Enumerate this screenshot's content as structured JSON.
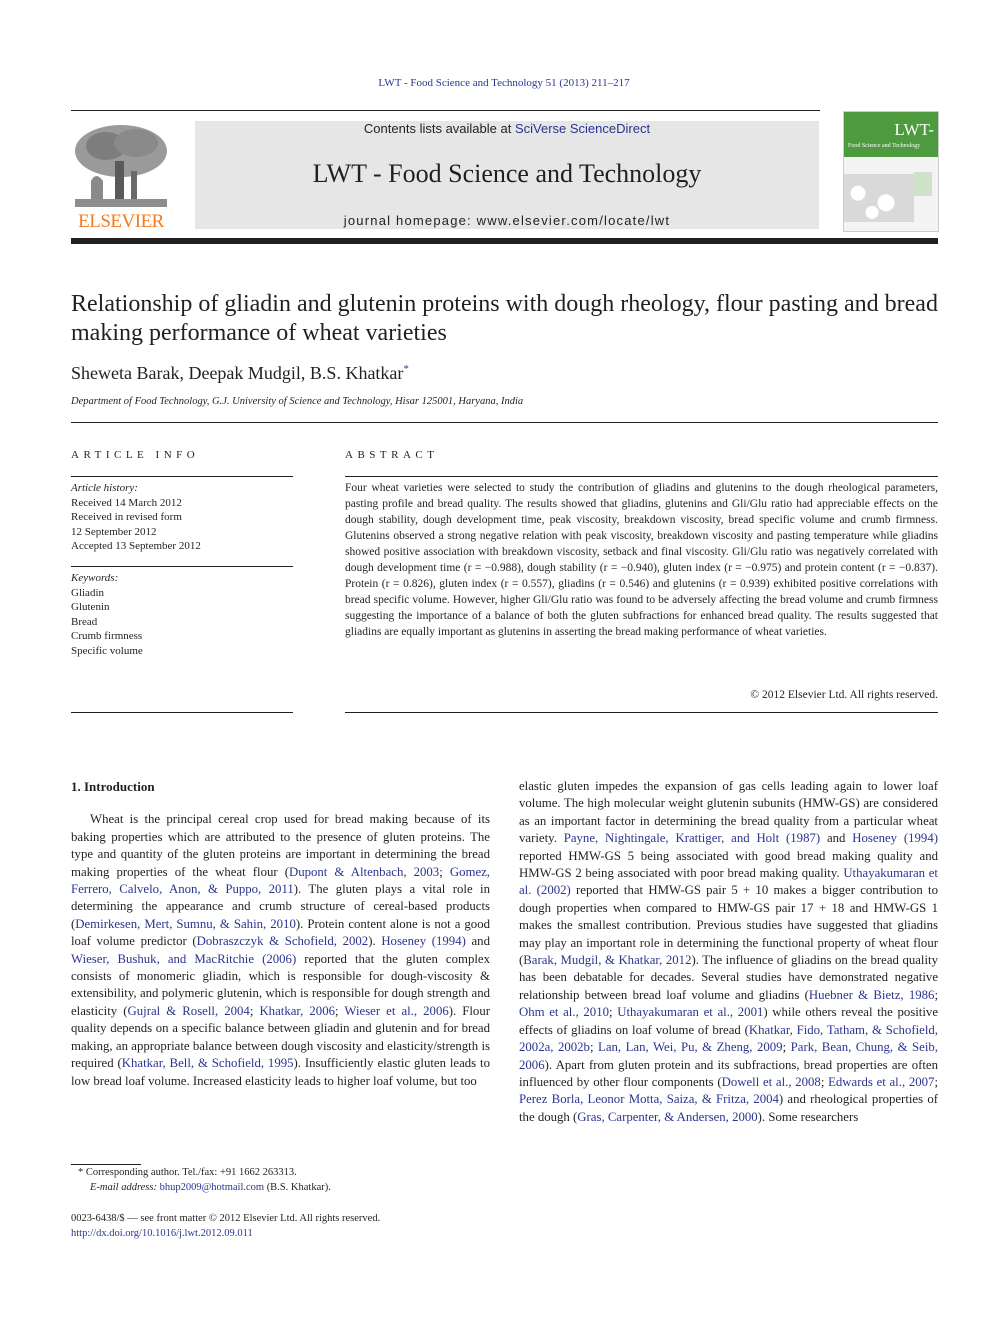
{
  "header": {
    "running_head": "LWT - Food Science and Technology 51 (2013) 211–217",
    "contents_prefix": "Contents lists available at ",
    "contents_link": "SciVerse ScienceDirect",
    "journal_title": "LWT - Food Science and Technology",
    "homepage": "journal homepage: www.elsevier.com/locate/lwt",
    "publisher_logo_text": "ELSEVIER",
    "cover_title": "LWT-",
    "cover_subtitle": "Food Science and Technology"
  },
  "colors": {
    "link": "#2a3590",
    "elsevier_orange": "#f47b20",
    "cover_green": "#4e9a3f",
    "banner_gray": "#e6e6e6"
  },
  "article": {
    "title": "Relationship of gliadin and glutenin proteins with dough rheology, flour pasting and bread making performance of wheat varieties",
    "authors": "Sheweta Barak, Deepak Mudgil, B.S. Khatkar",
    "author_mark": "*",
    "affiliation": "Department of Food Technology, G.J. University of Science and Technology, Hisar 125001, Haryana, India"
  },
  "article_info": {
    "heading": "ARTICLE INFO",
    "history_label": "Article history:",
    "history": [
      "Received 14 March 2012",
      "Received in revised form",
      "12 September 2012",
      "Accepted 13 September 2012"
    ],
    "keywords_label": "Keywords:",
    "keywords": [
      "Gliadin",
      "Glutenin",
      "Bread",
      "Crumb firmness",
      "Specific volume"
    ]
  },
  "abstract": {
    "heading": "ABSTRACT",
    "text": "Four wheat varieties were selected to study the contribution of gliadins and glutenins to the dough rheological parameters, pasting profile and bread quality. The results showed that gliadins, glutenins and Gli/Glu ratio had appreciable effects on the dough stability, dough development time, peak viscosity, breakdown viscosity, bread specific volume and crumb firmness. Glutenins observed a strong negative relation with peak viscosity, breakdown viscosity and pasting temperature while gliadins showed positive association with breakdown viscosity, setback and final viscosity. Gli/Glu ratio was negatively correlated with dough development time (r = −0.988), dough stability (r = −0.940), gluten index (r = −0.975) and protein content (r = −0.837). Protein (r = 0.826), gluten index (r = 0.557), gliadins (r = 0.546) and glutenins (r = 0.939) exhibited positive correlations with bread specific volume. However, higher Gli/Glu ratio was found to be adversely affecting the bread volume and crumb firmness suggesting the importance of a balance of both the gluten subfractions for enhanced bread quality. The results suggested that gliadins are equally important as glutenins in asserting the bread making performance of wheat varieties.",
    "copyright": "© 2012 Elsevier Ltd. All rights reserved."
  },
  "body": {
    "section_heading": "1.  Introduction",
    "left": [
      {
        "t": "Wheat is the principal cereal crop used for bread making because of its baking properties which are attributed to the presence of gluten proteins. The type and quantity of the gluten proteins are important in determining the bread making properties of the wheat flour ("
      },
      {
        "l": "Dupont & Altenbach, 2003"
      },
      {
        "t": "; "
      },
      {
        "l": "Gomez, Ferrero, Calvelo, Anon, & Puppo, 2011"
      },
      {
        "t": "). The gluten plays a vital role in determining the appearance and crumb structure of cereal-based products ("
      },
      {
        "l": "Demirkesen, Mert, Sumnu, & Sahin, 2010"
      },
      {
        "t": "). Protein content alone is not a good loaf volume predictor ("
      },
      {
        "l": "Dobraszczyk & Schofield, 2002"
      },
      {
        "t": "). "
      },
      {
        "l": "Hoseney (1994)"
      },
      {
        "t": " and "
      },
      {
        "l": "Wieser, Bushuk, and MacRitchie (2006)"
      },
      {
        "t": " reported that the gluten complex consists of monomeric gliadin, which is responsible for dough-viscosity & extensibility, and polymeric glutenin, which is responsible for dough strength and elasticity ("
      },
      {
        "l": "Gujral & Rosell, 2004"
      },
      {
        "t": "; "
      },
      {
        "l": "Khatkar, 2006"
      },
      {
        "t": "; "
      },
      {
        "l": "Wieser et al., 2006"
      },
      {
        "t": "). Flour quality depends on a specific balance between gliadin and glutenin and for bread making, an appropriate balance between dough viscosity and elasticity/strength is required ("
      },
      {
        "l": "Khatkar, Bell, & Schofield, 1995"
      },
      {
        "t": "). Insufficiently elastic gluten leads to low bread loaf volume. Increased elasticity leads to higher loaf volume, but too"
      }
    ],
    "right": [
      {
        "t": "elastic gluten impedes the expansion of gas cells leading again to lower loaf volume. The high molecular weight glutenin subunits (HMW-GS) are considered as an important factor in determining the bread quality from a particular wheat variety. "
      },
      {
        "l": "Payne, Nightingale, Krattiger, and Holt (1987)"
      },
      {
        "t": " and "
      },
      {
        "l": "Hoseney (1994)"
      },
      {
        "t": " reported HMW-GS 5 being associated with good bread making quality and HMW-GS 2 being associated with poor bread making quality. "
      },
      {
        "l": "Uthayakumaran et al. (2002)"
      },
      {
        "t": " reported that HMW-GS pair 5 + 10 makes a bigger contribution to dough properties when compared to HMW-GS pair 17 + 18 and HMW-GS 1 makes the smallest contribution. Previous studies have suggested that gliadins may play an important role in determining the functional property of wheat flour ("
      },
      {
        "l": "Barak, Mudgil, & Khatkar, 2012"
      },
      {
        "t": "). The influence of gliadins on the bread quality has been debatable for decades. Several studies have demonstrated negative relationship between bread loaf volume and gliadins ("
      },
      {
        "l": "Huebner & Bietz, 1986"
      },
      {
        "t": "; "
      },
      {
        "l": "Ohm et al., 2010"
      },
      {
        "t": "; "
      },
      {
        "l": "Uthayakumaran et al., 2001"
      },
      {
        "t": ") while others reveal the positive effects of gliadins on loaf volume of bread ("
      },
      {
        "l": "Khatkar, Fido, Tatham, & Schofield, 2002a, 2002b"
      },
      {
        "t": "; "
      },
      {
        "l": "Lan, Lan, Wei, Pu, & Zheng, 2009"
      },
      {
        "t": "; "
      },
      {
        "l": "Park, Bean, Chung, & Seib, 2006"
      },
      {
        "t": "). Apart from gluten protein and its subfractions, bread properties are often influenced by other flour components ("
      },
      {
        "l": "Dowell et al., 2008"
      },
      {
        "t": "; "
      },
      {
        "l": "Edwards et al., 2007"
      },
      {
        "t": "; "
      },
      {
        "l": "Perez Borla, Leonor Motta, Saiza, & Fritza, 2004"
      },
      {
        "t": ") and rheological properties of the dough ("
      },
      {
        "l": "Gras, Carpenter, & Andersen, 2000"
      },
      {
        "t": "). Some researchers"
      }
    ]
  },
  "footnotes": {
    "corresponding": "* Corresponding author. Tel./fax: +91 1662 263313.",
    "email_label": "E-mail address: ",
    "email": "bhup2009@hotmail.com",
    "email_suffix": " (B.S. Khatkar).",
    "front_matter": "0023-6438/$ — see front matter © 2012 Elsevier Ltd. All rights reserved.",
    "doi": "http://dx.doi.org/10.1016/j.lwt.2012.09.011"
  }
}
